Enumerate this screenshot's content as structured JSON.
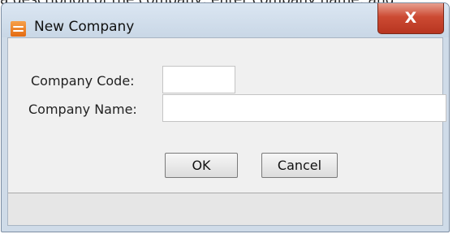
{
  "background_text": "a description of the company, enter company name, and",
  "window": {
    "title": "New Company",
    "close_label": "X"
  },
  "form": {
    "company_code": {
      "label": "Company Code:",
      "value": ""
    },
    "company_name": {
      "label": "Company Name:",
      "value": ""
    }
  },
  "buttons": {
    "ok_label": "OK",
    "cancel_label": "Cancel"
  },
  "colors": {
    "accent": "#cc4a33",
    "frame": "#cfdbe8",
    "content": "#f0f0f0"
  },
  "icons": {
    "app": "document-stack-icon",
    "close": "close-icon"
  }
}
